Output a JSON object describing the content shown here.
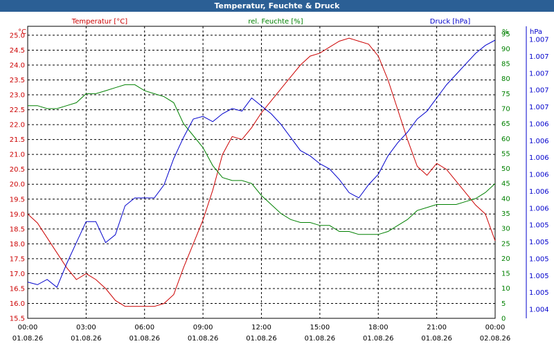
{
  "window": {
    "title": "Temperatur, Feuchte & Druck"
  },
  "colors": {
    "temperature": "#cc0000",
    "humidity": "#008000",
    "pressure": "#0000cc",
    "axis": "#000000"
  },
  "chart_data": {
    "type": "line",
    "title": "Temperatur, Feuchte & Druck",
    "grid": true,
    "x_ticks": [
      {
        "time": "00:00",
        "date": "01.08.26"
      },
      {
        "time": "03:00",
        "date": "01.08.26"
      },
      {
        "time": "06:00",
        "date": "01.08.26"
      },
      {
        "time": "09:00",
        "date": "01.08.26"
      },
      {
        "time": "12:00",
        "date": "01.08.26"
      },
      {
        "time": "15:00",
        "date": "01.08.26"
      },
      {
        "time": "18:00",
        "date": "01.08.26"
      },
      {
        "time": "21:00",
        "date": "01.08.26"
      },
      {
        "time": "00:00",
        "date": "02.08.26"
      }
    ],
    "axes": {
      "temperature": {
        "label": "Temperatur [°C]",
        "unit": "°C",
        "ylim": [
          15.5,
          25.3
        ],
        "ticks": [
          "15.5",
          "16.0",
          "16.5",
          "17.0",
          "17.5",
          "18.0",
          "18.5",
          "19.0",
          "19.5",
          "20.0",
          "20.5",
          "21.0",
          "21.5",
          "22.0",
          "22.5",
          "23.0",
          "23.5",
          "24.0",
          "24.5",
          "25.0"
        ]
      },
      "humidity": {
        "label": "rel. Feuchte [%]",
        "unit": "%",
        "ylim": [
          0,
          97.5
        ],
        "ticks": [
          "0",
          "5",
          "10",
          "15",
          "20",
          "25",
          "30",
          "35",
          "40",
          "45",
          "50",
          "55",
          "60",
          "65",
          "70",
          "75",
          "80",
          "85",
          "90",
          "95"
        ]
      },
      "pressure": {
        "label": "Druck [hPa]",
        "unit": "hPa",
        "ticks": [
          "1.004",
          "1.005",
          "1.005",
          "1.005",
          "1.005",
          "1.005",
          "1.006",
          "1.006",
          "1.006",
          "1.006",
          "1.006",
          "1.006",
          "1.007",
          "1.007",
          "1.007",
          "1.007",
          "1.007"
        ]
      }
    },
    "series": [
      {
        "name": "Temperatur [°C]",
        "axis": "temperature",
        "x": [
          0,
          0.5,
          1,
          1.5,
          2,
          2.5,
          3,
          3.5,
          4,
          4.5,
          5,
          5.5,
          6,
          6.5,
          7,
          7.5,
          8,
          8.5,
          9,
          9.5,
          10,
          10.5,
          11,
          11.5,
          12,
          12.5,
          13,
          13.5,
          14,
          14.5,
          15,
          15.5,
          16,
          16.5,
          17,
          17.5,
          18,
          18.5,
          19,
          19.5,
          20,
          20.5,
          21,
          21.5,
          22,
          22.5,
          23,
          23.5,
          24
        ],
        "y": [
          19.0,
          18.7,
          18.2,
          17.7,
          17.2,
          16.8,
          17.0,
          16.8,
          16.5,
          16.1,
          15.9,
          15.9,
          15.9,
          15.9,
          16.0,
          16.3,
          17.2,
          18.0,
          18.8,
          19.8,
          21.0,
          21.6,
          21.5,
          21.9,
          22.4,
          22.8,
          23.2,
          23.6,
          24.0,
          24.3,
          24.4,
          24.6,
          24.8,
          24.9,
          24.8,
          24.7,
          24.3,
          23.5,
          22.5,
          21.5,
          20.6,
          20.3,
          20.7,
          20.5,
          20.1,
          19.7,
          19.3,
          19.0,
          18.1
        ]
      },
      {
        "name": "rel. Feuchte [%]",
        "axis": "humidity",
        "x": [
          0,
          0.5,
          1,
          1.5,
          2,
          2.5,
          3,
          3.5,
          4,
          4.5,
          5,
          5.5,
          6,
          6.5,
          7,
          7.5,
          8,
          8.5,
          9,
          9.5,
          10,
          10.5,
          11,
          11.5,
          12,
          12.5,
          13,
          13.5,
          14,
          14.5,
          15,
          15.5,
          16,
          16.5,
          17,
          17.5,
          18,
          18.5,
          19,
          19.5,
          20,
          20.5,
          21,
          21.5,
          22,
          22.5,
          23,
          23.5,
          24
        ],
        "y": [
          71,
          71,
          70,
          70,
          71,
          72,
          75,
          75,
          76,
          77,
          78,
          78,
          76,
          75,
          74,
          72,
          65,
          61,
          57,
          51,
          47,
          46,
          46,
          45,
          41,
          38,
          35,
          33,
          32,
          32,
          31,
          31,
          29,
          29,
          28,
          28,
          28,
          29,
          31,
          33,
          36,
          37,
          38,
          38,
          38,
          39,
          40,
          42,
          45
        ]
      },
      {
        "name": "Druck [hPa]",
        "axis": "pressure",
        "x": [
          0,
          0.5,
          1,
          1.5,
          2,
          2.5,
          3,
          3.5,
          4,
          4.5,
          5,
          5.5,
          6,
          6.5,
          7,
          7.5,
          8,
          8.5,
          9,
          9.5,
          10,
          10.5,
          11,
          11.5,
          12,
          12.5,
          13,
          13.5,
          14,
          14.5,
          15,
          15.5,
          16,
          16.5,
          17,
          17.5,
          18,
          18.5,
          19,
          19.5,
          20,
          20.5,
          21,
          21.5,
          22,
          22.5,
          23,
          23.5,
          24
        ],
        "y": [
          0.08,
          0.07,
          0.09,
          0.06,
          0.15,
          0.23,
          0.31,
          0.31,
          0.23,
          0.26,
          0.37,
          0.4,
          0.4,
          0.4,
          0.45,
          0.55,
          0.63,
          0.7,
          0.71,
          0.69,
          0.72,
          0.74,
          0.73,
          0.78,
          0.75,
          0.72,
          0.68,
          0.63,
          0.58,
          0.56,
          0.53,
          0.51,
          0.47,
          0.42,
          0.4,
          0.45,
          0.49,
          0.56,
          0.61,
          0.65,
          0.7,
          0.73,
          0.78,
          0.83,
          0.87,
          0.91,
          0.95,
          0.98,
          1.0
        ]
      }
    ]
  }
}
